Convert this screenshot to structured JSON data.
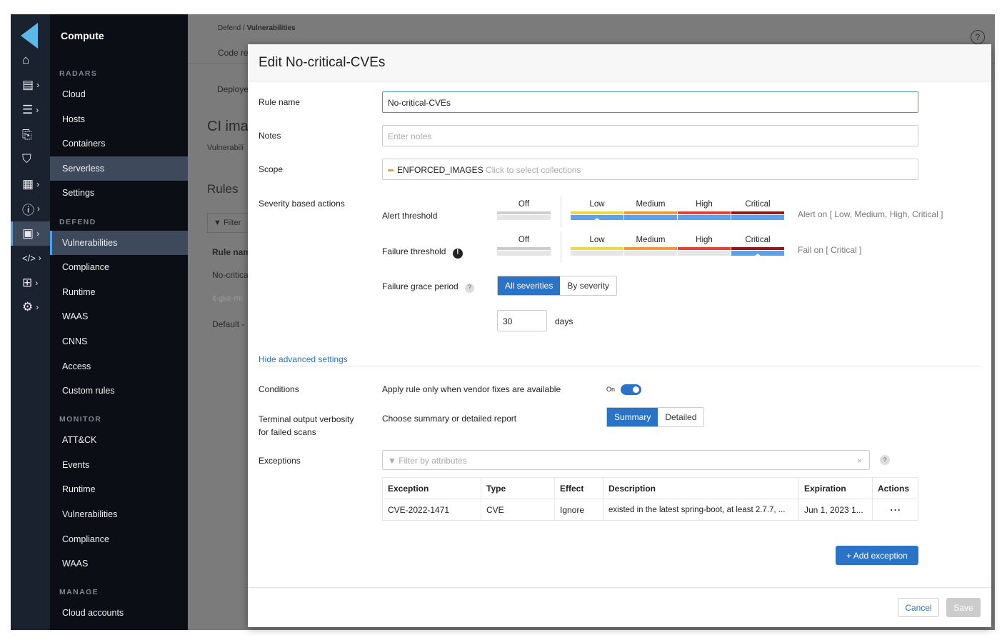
{
  "app": {
    "title": "Compute",
    "accent": "#2a73c7"
  },
  "rail": [
    {
      "icon": "home-icon",
      "glyph": "⌂"
    },
    {
      "icon": "dashboard-icon",
      "glyph": "▤"
    },
    {
      "icon": "list-icon",
      "glyph": "☰"
    },
    {
      "icon": "monitor-search-icon",
      "glyph": "⎘"
    },
    {
      "icon": "shield-icon",
      "glyph": "⛉"
    },
    {
      "icon": "report-icon",
      "glyph": "▦"
    },
    {
      "icon": "alert-icon",
      "glyph": "ⓘ"
    },
    {
      "icon": "chip-icon",
      "glyph": "▣"
    },
    {
      "icon": "code-icon",
      "glyph": "</>"
    },
    {
      "icon": "network-icon",
      "glyph": "⊞"
    },
    {
      "icon": "gear-icon",
      "glyph": "⚙"
    }
  ],
  "nav": {
    "sections": [
      "RADARS",
      "DEFEND",
      "MONITOR",
      "MANAGE"
    ],
    "items": [
      "Cloud",
      "Hosts",
      "Containers",
      "Serverless",
      "Settings",
      "Vulnerabilities",
      "Compliance",
      "Runtime",
      "WAAS",
      "CNNS",
      "Access",
      "Custom rules",
      "ATT&CK",
      "Events",
      "Runtime",
      "Vulnerabilities",
      "Compliance",
      "WAAS",
      "Cloud accounts"
    ]
  },
  "background": {
    "breadcrumb_a": "Defend / ",
    "breadcrumb_b": "Vulnerabilities",
    "tab1": "Code re",
    "tab2": "Deploye",
    "title": "CI ima",
    "subtitle": "Vulnerabili",
    "rules": "Rules",
    "filter": "Filter",
    "col": "Rule nam",
    "rows": [
      "No-critica",
      "it-gke-mi",
      "Default -"
    ],
    "help": "?"
  },
  "modal": {
    "title": "Edit No-critical-CVEs",
    "rule_name_label": "Rule name",
    "rule_name_value": "No-critical-CVEs",
    "notes_label": "Notes",
    "notes_placeholder": "Enter notes",
    "scope_label": "Scope",
    "scope_chip": "ENFORCED_IMAGES",
    "scope_hint": "Click to select collections",
    "severity_label": "Severity based actions",
    "alert_label": "Alert threshold",
    "failure_label": "Failure threshold",
    "levels": [
      "Off",
      "Low",
      "Medium",
      "High",
      "Critical"
    ],
    "level_colors": [
      "#e9d84a",
      "#ef9a3a",
      "#e2413a",
      "#8e1b1b"
    ],
    "alert_threshold": "Low",
    "failure_threshold": "Critical",
    "alert_summary": "Alert on [ Low, Medium, High, Critical ]",
    "failure_summary": "Fail on [ Critical ]",
    "grace_label": "Failure grace period",
    "grace_options": [
      "All severities",
      "By severity"
    ],
    "grace_selected": "All severities",
    "grace_days": "30",
    "days_unit": "days",
    "advanced_link": "Hide advanced settings",
    "conditions_label": "Conditions",
    "conditions_text": "Apply rule only when vendor fixes are available",
    "toggle_label": "On",
    "toggle_on": true,
    "verbosity_label1": "Terminal output verbosity",
    "verbosity_label2": "for failed scans",
    "verbosity_text": "Choose summary or detailed report",
    "verbosity_options": [
      "Summary",
      "Detailed"
    ],
    "exceptions_label": "Exceptions",
    "exceptions_filter_placeholder": "Filter by attributes",
    "table": {
      "headers": [
        "Exception",
        "Type",
        "Effect",
        "Description",
        "Expiration",
        "Actions"
      ],
      "rows": [
        [
          "CVE-2022-1471",
          "CVE",
          "Ignore",
          "existed in the latest spring-boot, at least 2.7.7, ...",
          "Jun 1, 2023 1...",
          "⋯"
        ]
      ]
    },
    "add_exception": "+  Add exception",
    "cancel": "Cancel",
    "save": "Save"
  }
}
